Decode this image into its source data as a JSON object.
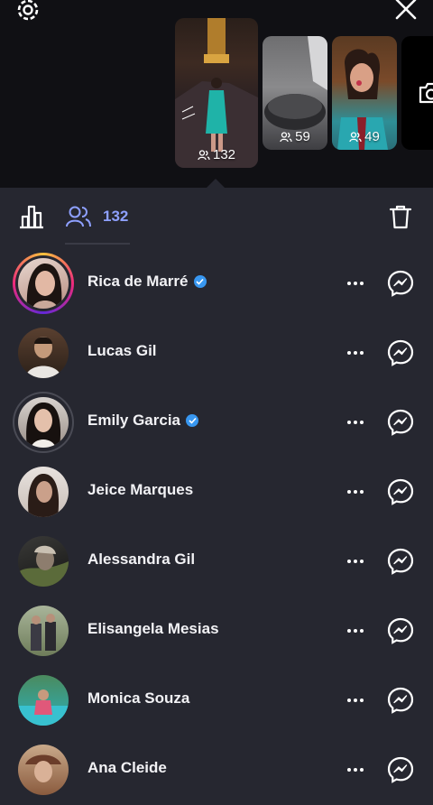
{
  "stories": [
    {
      "viewers": "132"
    },
    {
      "viewers": "59"
    },
    {
      "viewers": "49"
    }
  ],
  "viewers_tab": {
    "count": "132"
  },
  "viewers": [
    {
      "name": "Rica de Marré",
      "verified": true,
      "has_story_ring": true
    },
    {
      "name": "Lucas Gil",
      "verified": false,
      "has_story_ring": false
    },
    {
      "name": "Emily Garcia",
      "verified": true,
      "has_story_ring": false
    },
    {
      "name": "Jeice Marques",
      "verified": false,
      "has_story_ring": false
    },
    {
      "name": "Alessandra Gil",
      "verified": false,
      "has_story_ring": false
    },
    {
      "name": "Elisangela Mesias",
      "verified": false,
      "has_story_ring": false
    },
    {
      "name": "Monica Souza",
      "verified": false,
      "has_story_ring": false
    },
    {
      "name": "Ana Cleide",
      "verified": false,
      "has_story_ring": false
    }
  ],
  "colors": {
    "accent": "#8ea0ff",
    "verified": "#3897f0",
    "panel_bg": "#262730",
    "top_bg": "#101014"
  },
  "icons": {
    "settings": "gear-icon",
    "close": "close-icon",
    "camera": "camera-icon",
    "insights": "bar-chart-icon",
    "viewers": "people-icon",
    "delete": "trash-icon",
    "more": "more-dots-icon",
    "message": "messenger-icon"
  }
}
